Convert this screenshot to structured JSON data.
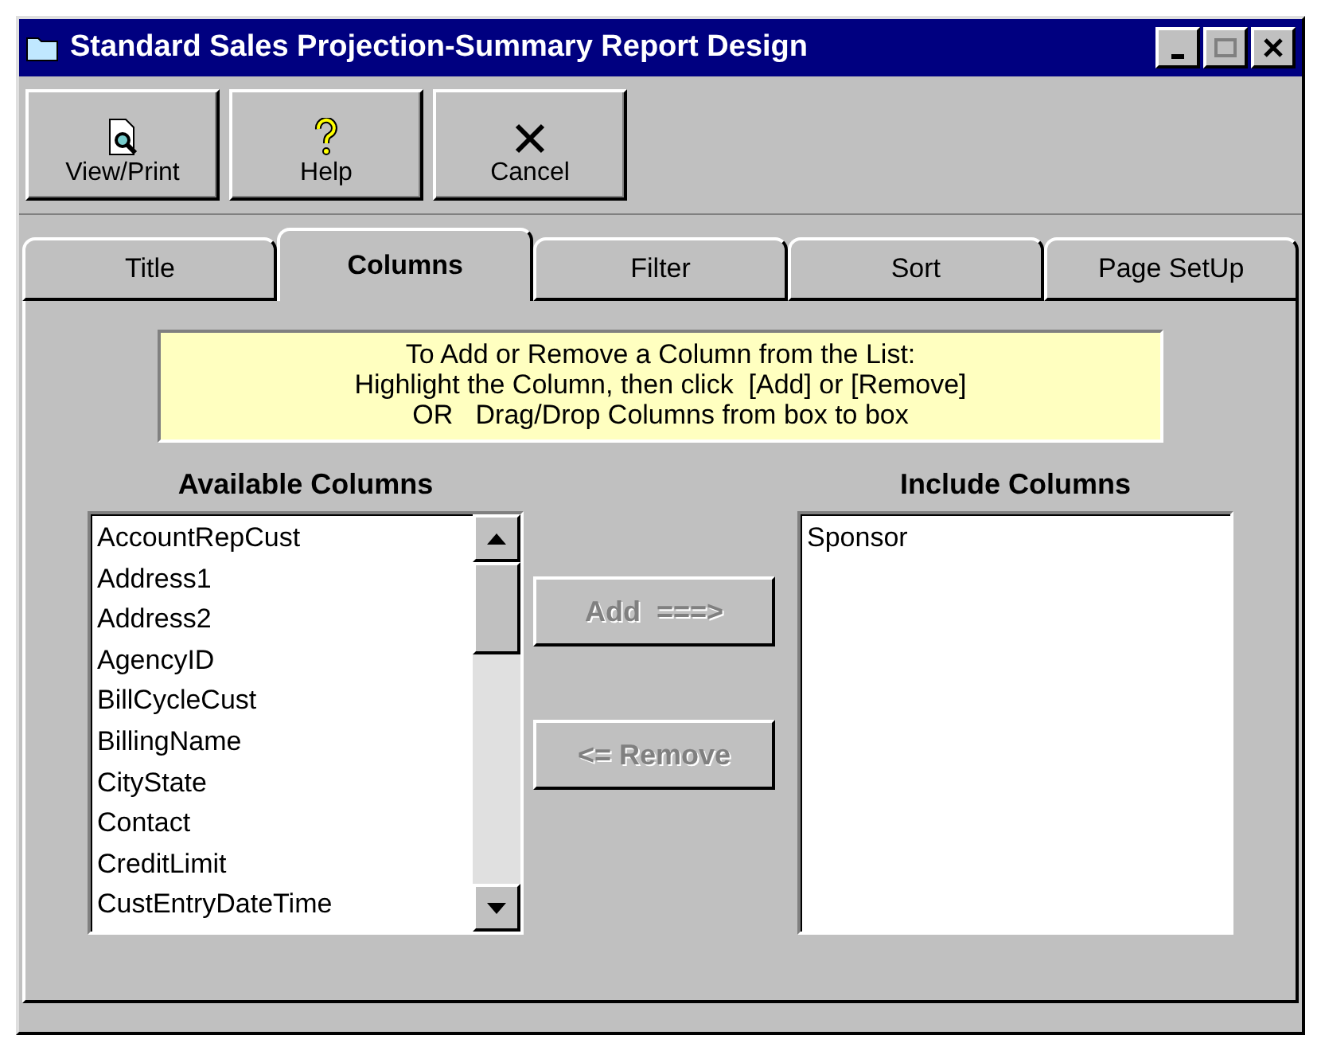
{
  "window": {
    "title": "Standard Sales Projection-Summary Report Design"
  },
  "toolbar": [
    {
      "label": "View/Print",
      "kind": "preview"
    },
    {
      "label": "Help",
      "kind": "help"
    },
    {
      "label": "Cancel",
      "kind": "cancel"
    }
  ],
  "tabs": [
    {
      "label": "Title",
      "selected": false
    },
    {
      "label": "Columns",
      "selected": true
    },
    {
      "label": "Filter",
      "selected": false
    },
    {
      "label": "Sort",
      "selected": false
    },
    {
      "label": "Page SetUp",
      "selected": false
    }
  ],
  "instructions": [
    "To Add or Remove a Column from the List:",
    "Highlight the Column, then click  [Add] or [Remove]",
    "OR   Drag/Drop Columns from box to box"
  ],
  "available_columns": {
    "label": "Available Columns",
    "items": [
      "AccountRepCust",
      "Address1",
      "Address2",
      "AgencyID",
      "BillCycleCust",
      "BillingName",
      "CityState",
      "Contact",
      "CreditLimit",
      "CustEntryDateTime"
    ]
  },
  "actions": [
    {
      "label": "Add  ===>",
      "disabled": true
    },
    {
      "label": "<= Remove",
      "disabled": true
    }
  ],
  "include_columns": {
    "label": "Include Columns",
    "items": [
      "Sponsor"
    ]
  }
}
